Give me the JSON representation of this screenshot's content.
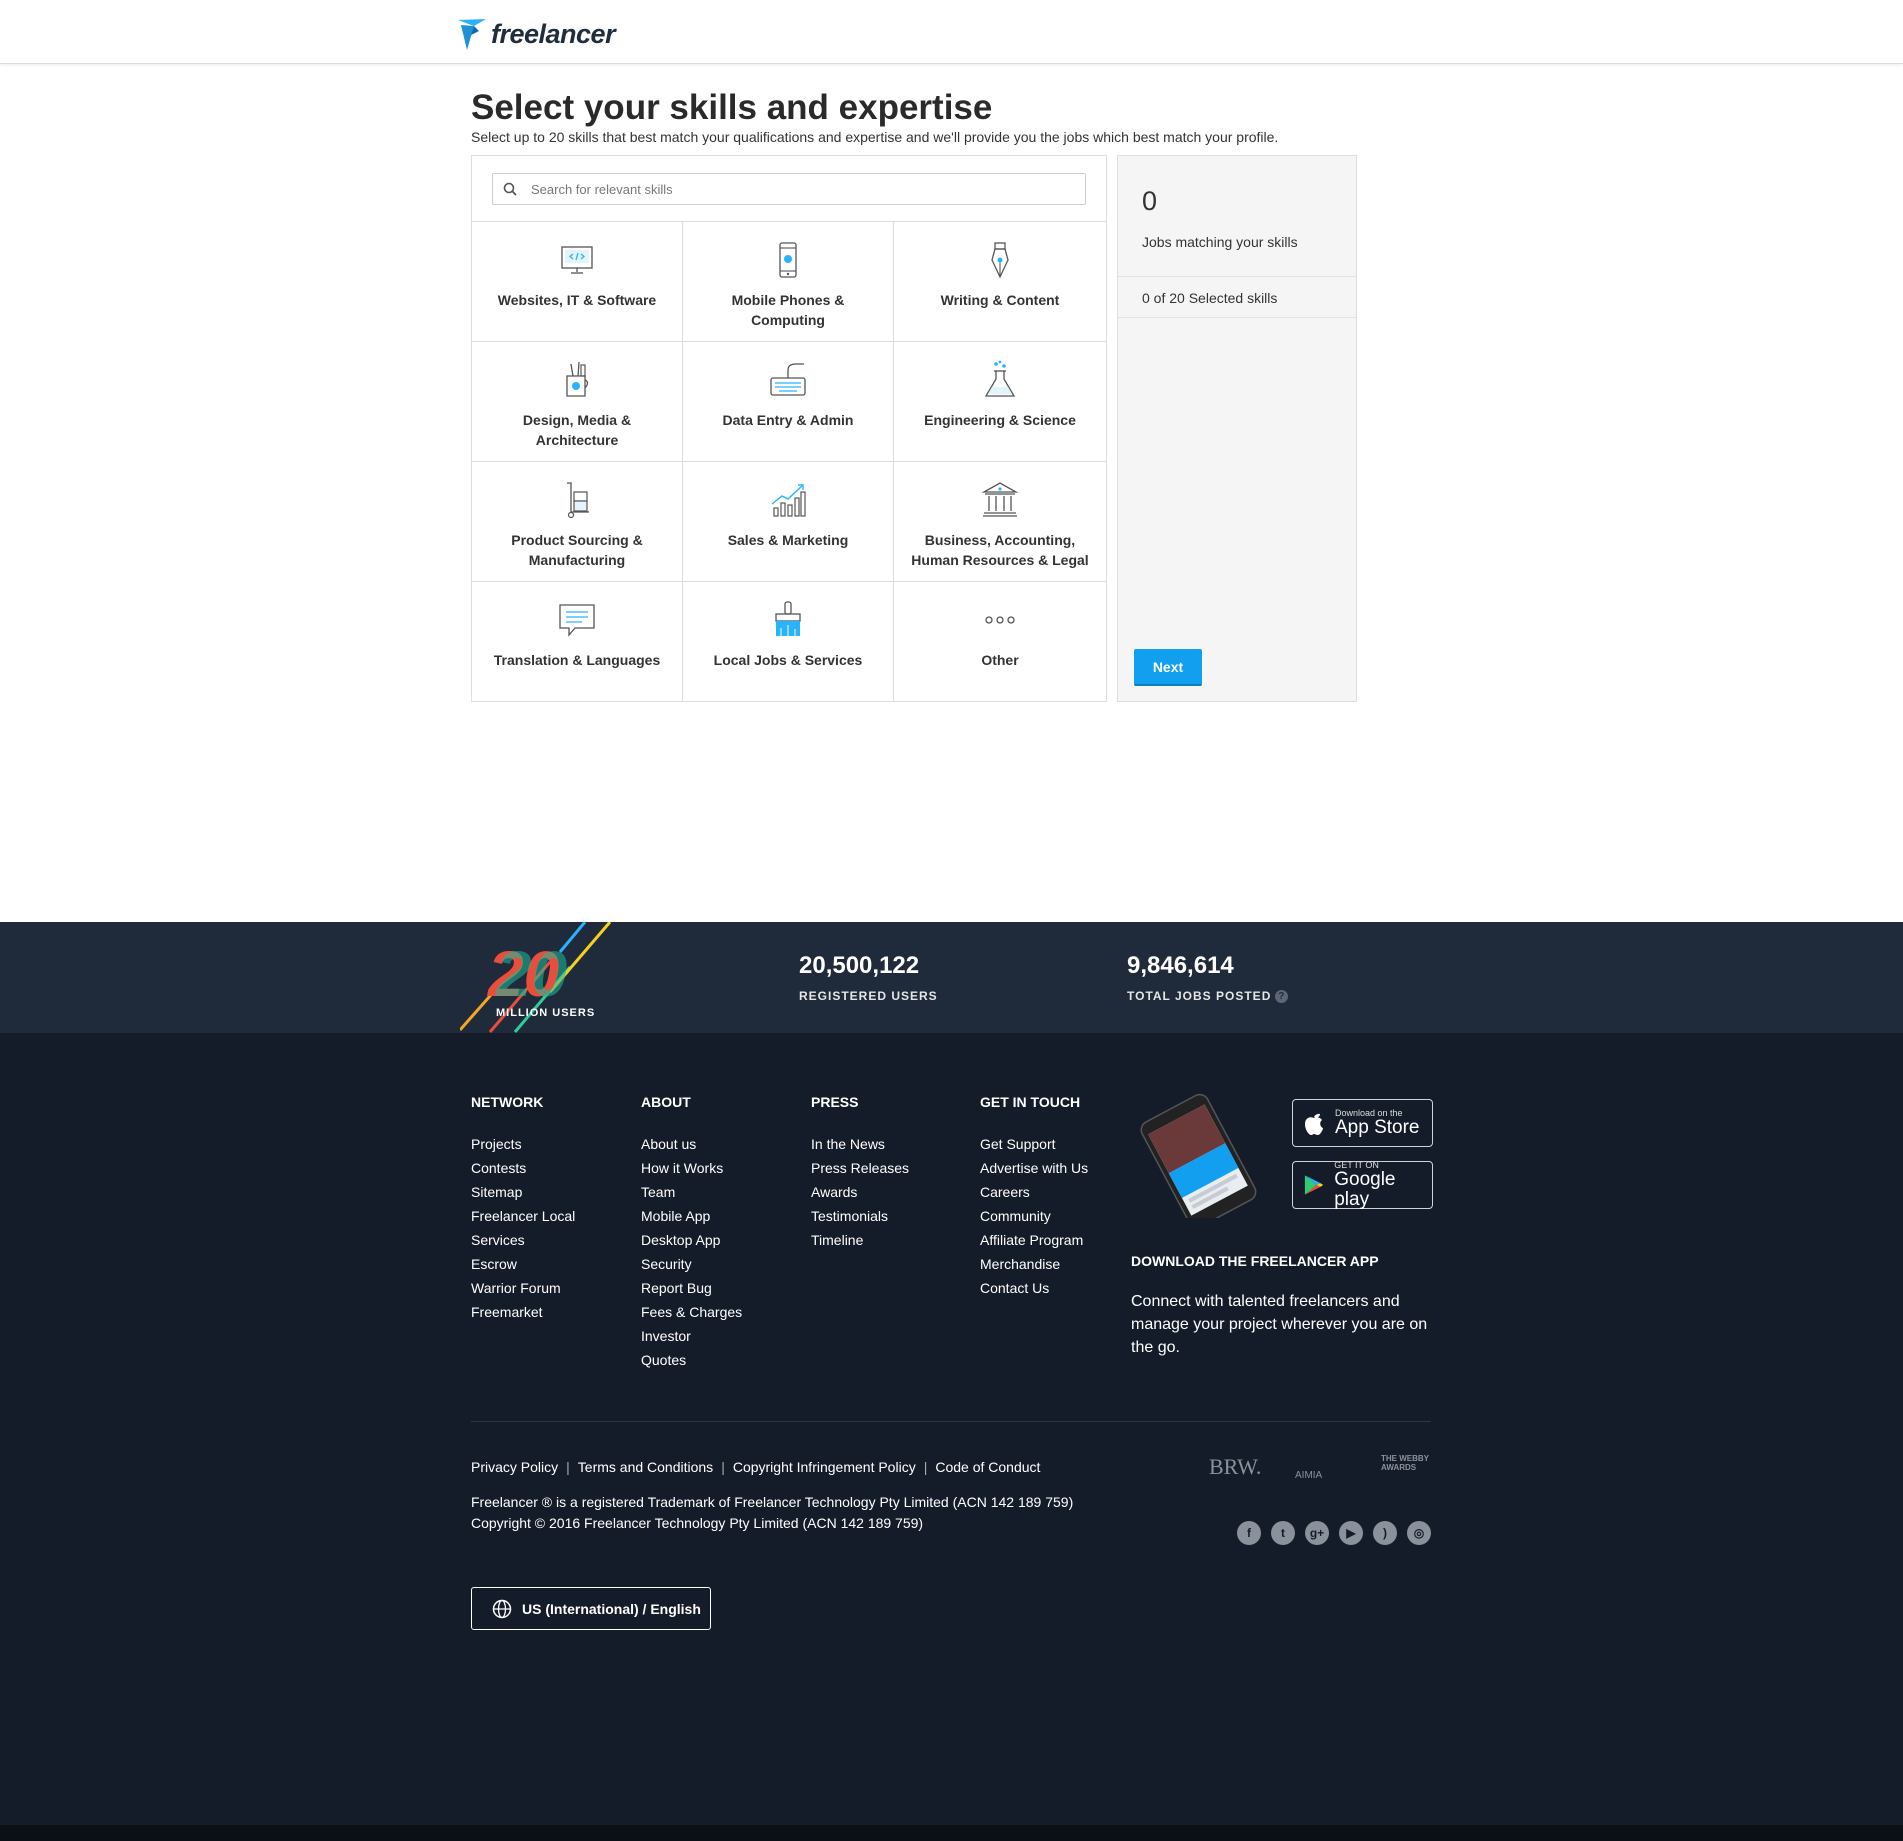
{
  "header": {
    "logo_text": "freelancer"
  },
  "main": {
    "title": "Select your skills and expertise",
    "subtitle": "Select up to 20 skills that best match your qualifications and expertise and we'll provide you the jobs which best match your profile.",
    "search": {
      "placeholder": "Search for relevant skills",
      "value": ""
    },
    "categories": [
      {
        "label": "Websites, IT & Software",
        "icon": "monitor-code-icon"
      },
      {
        "label": "Mobile Phones & Computing",
        "icon": "mobile-phone-icon"
      },
      {
        "label": "Writing & Content",
        "icon": "pen-nib-icon"
      },
      {
        "label": "Design, Media & Architecture",
        "icon": "design-cup-icon"
      },
      {
        "label": "Data Entry & Admin",
        "icon": "keyboard-icon"
      },
      {
        "label": "Engineering & Science",
        "icon": "flask-icon"
      },
      {
        "label": "Product Sourcing & Manufacturing",
        "icon": "hand-truck-icon"
      },
      {
        "label": "Sales & Marketing",
        "icon": "bar-chart-icon"
      },
      {
        "label": "Business, Accounting, Human Resources & Legal",
        "icon": "bank-icon"
      },
      {
        "label": "Translation & Languages",
        "icon": "speech-bubble-icon"
      },
      {
        "label": "Local Jobs & Services",
        "icon": "paint-brush-icon"
      },
      {
        "label": "Other",
        "icon": "more-dots-icon"
      }
    ]
  },
  "side": {
    "jobs_count": "0",
    "jobs_label": "Jobs matching your skills",
    "selected_text": "0 of 20 Selected skills",
    "next_label": "Next"
  },
  "stats": {
    "badge_label": "MILLION USERS",
    "badge_number": "20",
    "registered_users": "20,500,122",
    "registered_label": "REGISTERED USERS",
    "jobs_posted": "9,846,614",
    "jobs_posted_label": "TOTAL JOBS POSTED",
    "help_glyph": "?"
  },
  "footer": {
    "columns": [
      {
        "title": "NETWORK",
        "links": [
          "Projects",
          "Contests",
          "Sitemap",
          "Freelancer Local",
          "Services",
          "Escrow",
          "Warrior Forum",
          "Freemarket"
        ]
      },
      {
        "title": "ABOUT",
        "links": [
          "About us",
          "How it Works",
          "Team",
          "Mobile App",
          "Desktop App",
          "Security",
          "Report Bug",
          "Fees & Charges",
          "Investor",
          "Quotes"
        ]
      },
      {
        "title": "PRESS",
        "links": [
          "In the News",
          "Press Releases",
          "Awards",
          "Testimonials",
          "Timeline"
        ]
      },
      {
        "title": "GET IN TOUCH",
        "links": [
          "Get Support",
          "Advertise with Us",
          "Careers",
          "Community",
          "Affiliate Program",
          "Merchandise",
          "Contact Us"
        ]
      }
    ],
    "app": {
      "appstore_small": "Download on the",
      "appstore_big": "App Store",
      "googleplay_small": "GET IT ON",
      "googleplay_big": "Google play",
      "title": "DOWNLOAD THE FREELANCER APP",
      "description": "Connect with talented freelancers and manage your project wherever you are on the go."
    },
    "legal_links": [
      "Privacy Policy",
      "Terms and Conditions",
      "Copyright Infringement Policy",
      "Code of Conduct"
    ],
    "trademark": "Freelancer ® is a registered Trademark of Freelancer Technology Pty Limited (ACN 142 189 759)",
    "copyright": "Copyright © 2016 Freelancer Technology Pty Limited (ACN 142 189 759)",
    "awards": [
      "BRW.",
      "AIMIA",
      "THE WEBBY AWARDS"
    ],
    "social": [
      "facebook-icon",
      "twitter-icon",
      "google-plus-icon",
      "youtube-icon",
      "rss-icon",
      "instagram-icon"
    ],
    "language": "US (International) / English"
  }
}
